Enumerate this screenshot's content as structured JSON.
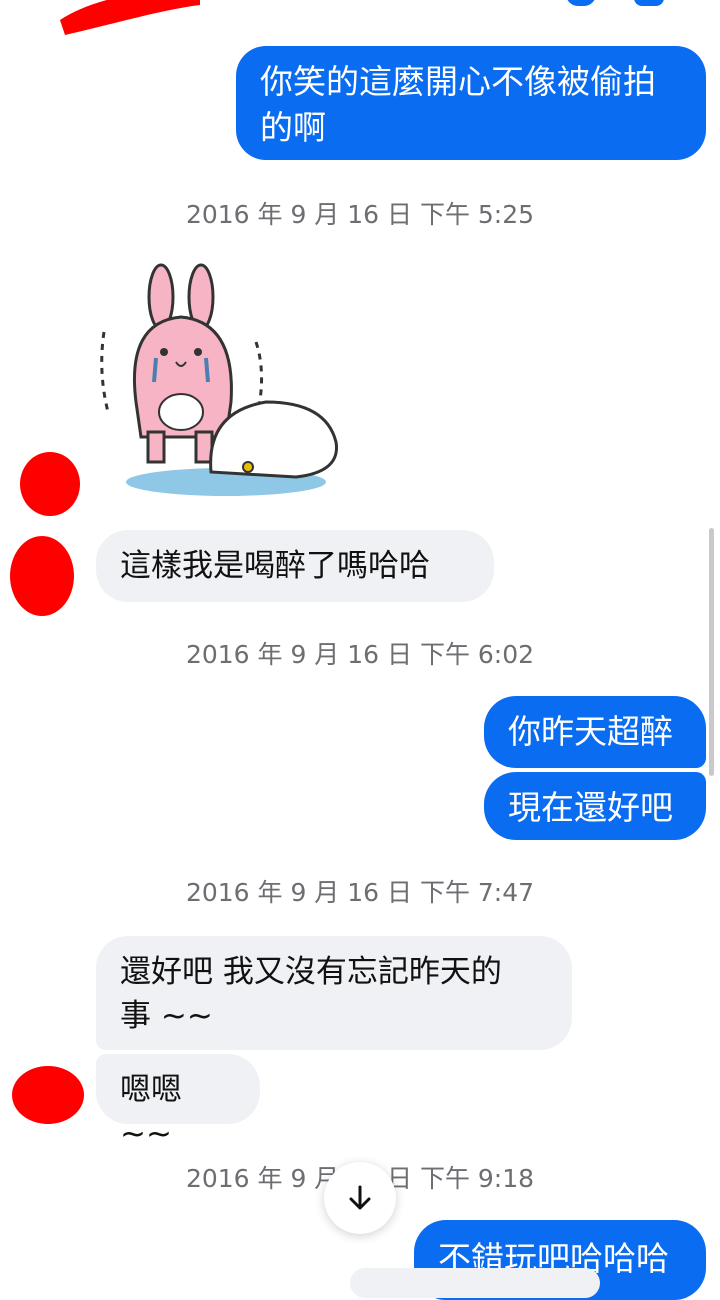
{
  "colors": {
    "outgoing_bubble": "#0a6cf0",
    "incoming_bubble": "#f0f1f4",
    "timestamp": "#6d6d72",
    "redaction": "#ff0000"
  },
  "messages": [
    {
      "type": "outgoing",
      "lines": [
        "你笑的這麼開心不像被偷拍",
        "的啊"
      ]
    },
    {
      "type": "timestamp",
      "text": "2016 年 9 月 16 日 下午 5:25"
    },
    {
      "type": "incoming_sticker",
      "icon": "crying-rabbit-sticker"
    },
    {
      "type": "incoming",
      "text": "這樣我是喝醉了嗎哈哈"
    },
    {
      "type": "timestamp",
      "text": "2016 年 9 月 16 日 下午 6:02"
    },
    {
      "type": "outgoing",
      "text": "你昨天超醉"
    },
    {
      "type": "outgoing",
      "text": "現在還好吧"
    },
    {
      "type": "timestamp",
      "text": "2016 年 9 月 16 日 下午 7:47"
    },
    {
      "type": "incoming",
      "lines": [
        "還好吧 我又沒有忘記昨天的",
        "事 ~~"
      ]
    },
    {
      "type": "incoming",
      "text": "嗯嗯 ~~"
    },
    {
      "type": "timestamp",
      "text": "2016 年 9 月 16 日 下午 9:18"
    },
    {
      "type": "outgoing",
      "text": "不錯玩吧哈哈哈"
    }
  ],
  "scroll_button": {
    "icon": "arrow-down-icon"
  }
}
